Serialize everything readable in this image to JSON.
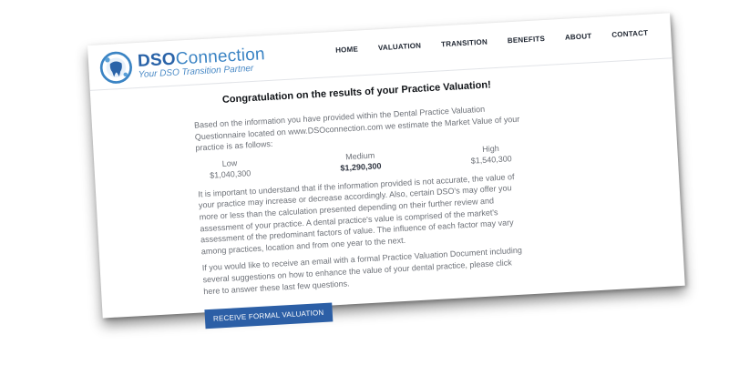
{
  "brand": {
    "name_bold": "DSO",
    "name_thin": "Connection",
    "tagline": "Your DSO Transition Partner"
  },
  "nav": {
    "items": [
      "HOME",
      "VALUATION",
      "TRANSITION",
      "BENEFITS",
      "ABOUT",
      "CONTACT"
    ]
  },
  "content": {
    "title": "Congratulation on the results of your Practice Valuation!",
    "intro": "Based on the information you have provided within the Dental Practice Valuation Questionnaire located on www.DSOconnection.com we estimate the Market Value of your practice is as follows:",
    "estimates": {
      "low_label": "Low",
      "low_value": "$1,040,300",
      "medium_label": "Medium",
      "medium_value": "$1,290,300",
      "high_label": "High",
      "high_value": "$1,540,300"
    },
    "disclaimer": "It is important to understand that if the information provided is not accurate, the value of your practice may increase or decrease accordingly. Also, certain DSO's may offer you more or less than the calculation presented depending on their further review and assessment of your practice. A dental practice's value is comprised of the market's assessment of the predominant factors of value. The influence of each factor may vary among practices, location and from one year to the next.",
    "email_offer": "If you would like to receive an email with a formal Practice Valuation Document including several suggestions on how to enhance the value of your dental practice, please click here to answer these last few questions.",
    "button_label": "RECEIVE FORMAL VALUATION"
  },
  "colors": {
    "brand_blue": "#2a63a8",
    "button_blue": "#2c5fa6"
  },
  "icons": [
    "tooth-logo-icon"
  ]
}
